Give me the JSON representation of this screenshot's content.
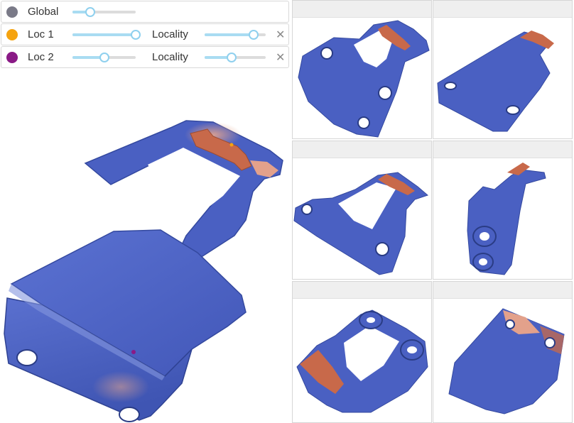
{
  "controls": {
    "global": {
      "label": "Global",
      "color": "#7a7a88",
      "value": 0.28
    },
    "loc1": {
      "label": "Loc 1",
      "color": "#f5a30f",
      "value": 1.0,
      "locality_label": "Locality",
      "locality_value": 0.8,
      "close_glyph": "✕"
    },
    "loc2": {
      "label": "Loc 2",
      "color": "#8a1a86",
      "value": 0.5,
      "locality_label": "Locality",
      "locality_value": 0.44,
      "close_glyph": "✕"
    }
  },
  "colors": {
    "mesh_blue": "#4b62c3",
    "mesh_blue_dark": "#33479a",
    "mesh_blue_light": "#7f93dc",
    "weight_orange": "#c8694a",
    "weight_peach": "#e3a18b",
    "slider_accent": "#8fd0ee",
    "header_bg": "#efefef"
  },
  "grid": {
    "cells": [
      {
        "name": "view-1"
      },
      {
        "name": "view-2"
      },
      {
        "name": "view-3"
      },
      {
        "name": "view-4"
      },
      {
        "name": "view-5"
      },
      {
        "name": "view-6"
      }
    ]
  }
}
